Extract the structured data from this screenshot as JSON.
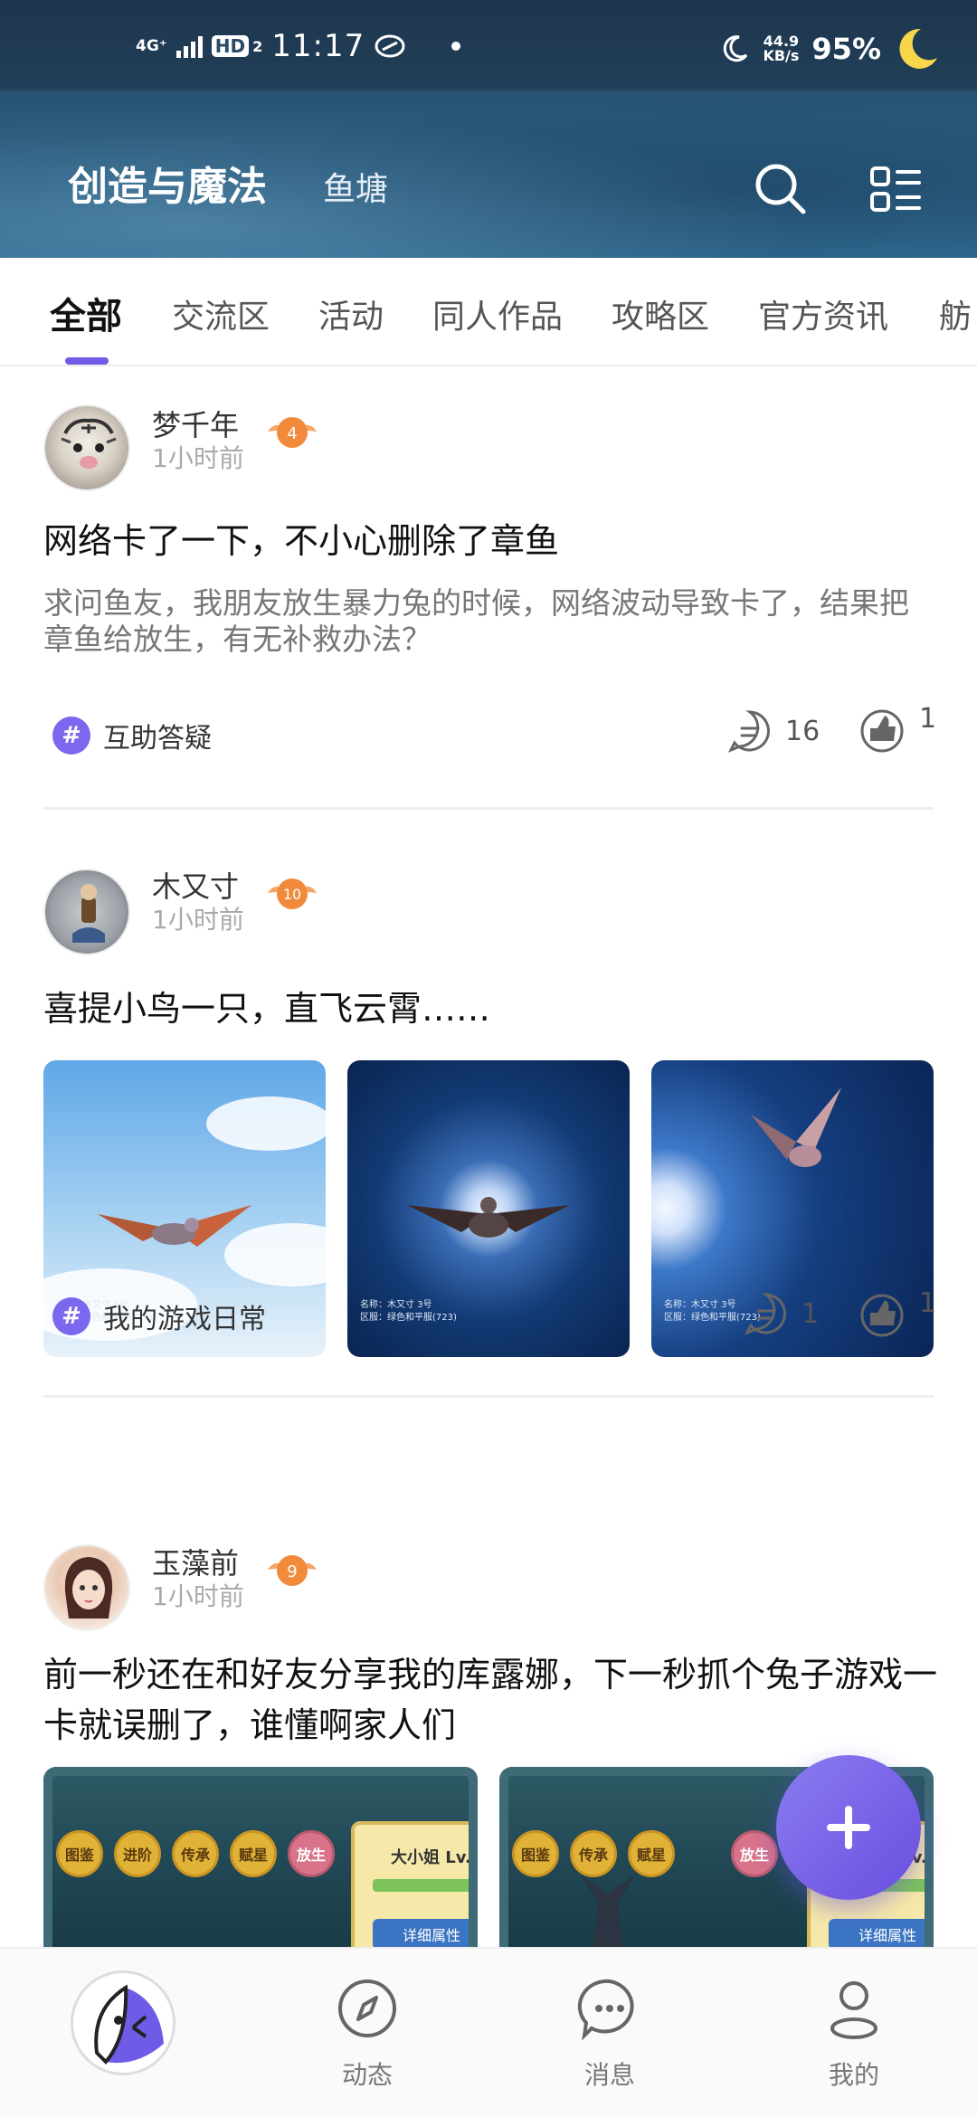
{
  "status_bar": {
    "network": "4G⁺",
    "hd": "HD",
    "hd_sub": "2",
    "time": "11:17",
    "speed_value": "44.9",
    "speed_unit": "KB/s",
    "battery": "95%"
  },
  "header": {
    "title": "创造与魔法",
    "subtitle": "鱼塘"
  },
  "tabs": [
    {
      "label": "全部",
      "active": true
    },
    {
      "label": "交流区"
    },
    {
      "label": "活动"
    },
    {
      "label": "同人作品"
    },
    {
      "label": "攻略区"
    },
    {
      "label": "官方资讯"
    },
    {
      "label": "舫"
    }
  ],
  "posts": [
    {
      "username": "梦千年",
      "time": "1小时前",
      "level": "4",
      "title": "网络卡了一下，不小心删除了章鱼",
      "body": "求问鱼友，我朋友放生暴力兔的时候，网络波动导致卡了，结果把章鱼给放生，有无补救办法？",
      "tag": "互助答疑",
      "comments": "16",
      "likes": "1"
    },
    {
      "username": "木又寸",
      "time": "1小时前",
      "level": "10",
      "title": "喜提小鸟一只，直飞云霄……",
      "images": [
        {
          "caption_line1": "名称：木又寸 3号",
          "caption_line2": "区服：绿色和平服(723)"
        },
        {
          "caption_line1": "名称：木又寸 3号",
          "caption_line2": "区服：绿色和平服(723)"
        },
        {
          "caption_line1": "名称：木又寸 3号",
          "caption_line2": "区服：绿色和平服(723)"
        }
      ],
      "tag": "我的游戏日常",
      "comments": "1",
      "likes": "1"
    },
    {
      "username": "玉藻前",
      "time": "1小时前",
      "level": "9",
      "title": "前一秒还在和好友分享我的库露娜，下一秒抓个兔子游戏一卡就误删了，谁懂啊家人们",
      "game_buttons_1": [
        "图鉴",
        "进阶",
        "传承",
        "赋星",
        "放生"
      ],
      "game_buttons_2": [
        "图鉴",
        "传承",
        "赋星",
        "放生"
      ],
      "game_panel_name": "大小姐 Lv.",
      "game_panel_button": "详细属性"
    }
  ],
  "bottom_nav": [
    {
      "label": "动态",
      "icon": "compass-icon"
    },
    {
      "label": "消息",
      "icon": "chat-icon"
    },
    {
      "label": "我的",
      "icon": "profile-icon"
    }
  ],
  "colors": {
    "accent": "#6f5ce6",
    "header_bg": "#2a5878",
    "tag_purple": "#7b68ee"
  }
}
